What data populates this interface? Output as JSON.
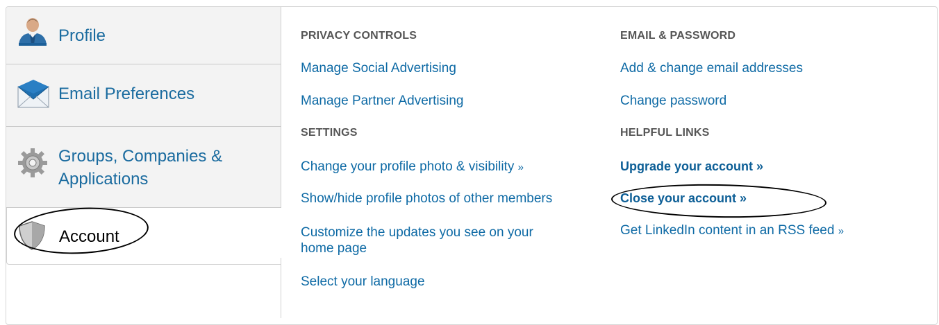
{
  "nav": {
    "profile": "Profile",
    "email_preferences": "Email Preferences",
    "groups_line1": "Groups, Companies &",
    "groups_line2": "Applications",
    "account": "Account"
  },
  "privacy": {
    "title": "PRIVACY CONTROLS",
    "social": "Manage Social Advertising",
    "partner": "Manage Partner Advertising"
  },
  "settings": {
    "title": "SETTINGS",
    "photo": "Change your profile photo & visibility",
    "photo_raq": "»",
    "showhide": "Show/hide profile photos of other members",
    "updates_line1": "Customize the updates you see on your",
    "updates_line2": "home page",
    "language": "Select your language"
  },
  "email_password": {
    "title": "EMAIL & PASSWORD",
    "emails": "Add & change email addresses",
    "password": "Change password"
  },
  "helpful": {
    "title": "HELPFUL LINKS",
    "upgrade": "Upgrade your account »",
    "close": "Close your account »",
    "rss": "Get LinkedIn content in an RSS feed",
    "rss_raq": "»"
  }
}
